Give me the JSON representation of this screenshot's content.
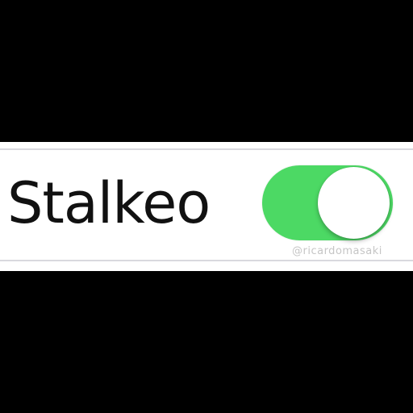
{
  "setting": {
    "label": "Stalkeo",
    "toggle_state": "on",
    "toggle_color": "#4cd964",
    "knob_color": "#ffffff"
  },
  "watermark": {
    "text": "@ricardomasaki"
  }
}
